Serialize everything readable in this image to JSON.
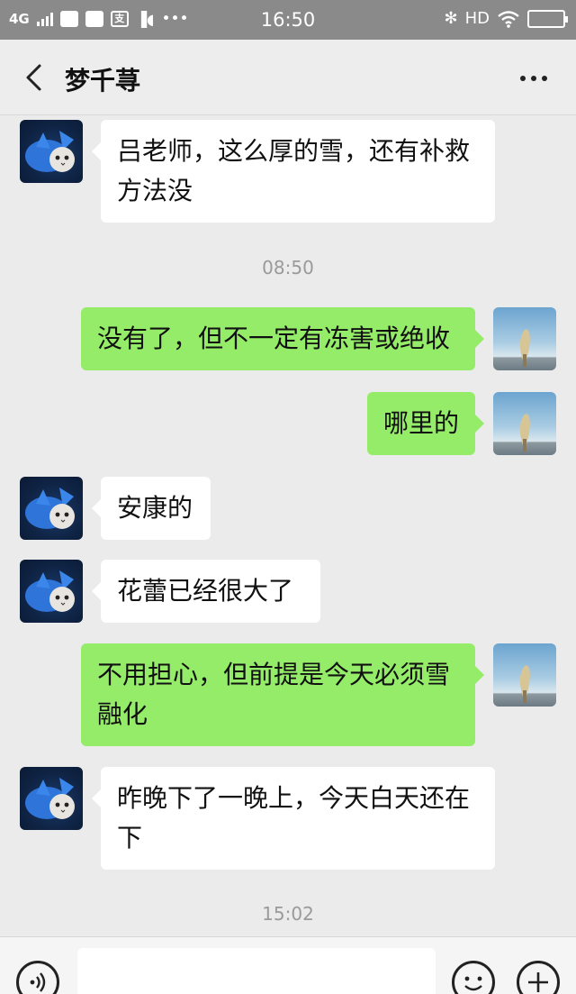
{
  "status_bar": {
    "network": "4G",
    "time": "16:50",
    "hd": "HD"
  },
  "header": {
    "title": "梦千荨"
  },
  "messages": [
    {
      "side": "left",
      "text": "吕老师，这么厚的雪，还有补救方法没"
    },
    {
      "side": "right",
      "text": "没有了，但不一定有冻害或绝收"
    },
    {
      "side": "right",
      "text": "哪里的"
    },
    {
      "side": "left",
      "text": "安康的"
    },
    {
      "side": "left",
      "text": "花蕾已经很大了"
    },
    {
      "side": "right",
      "text": "不用担心，但前提是今天必须雪融化"
    },
    {
      "side": "left",
      "text": "昨晚下了一晚上，今天白天还在下"
    }
  ],
  "timestamps": [
    "08:50",
    "15:02"
  ],
  "colors": {
    "chat_bg": "#ebebeb",
    "sent_bubble": "#95ec69",
    "received_bubble": "#ffffff",
    "status_bar": "#8a8a8a"
  }
}
